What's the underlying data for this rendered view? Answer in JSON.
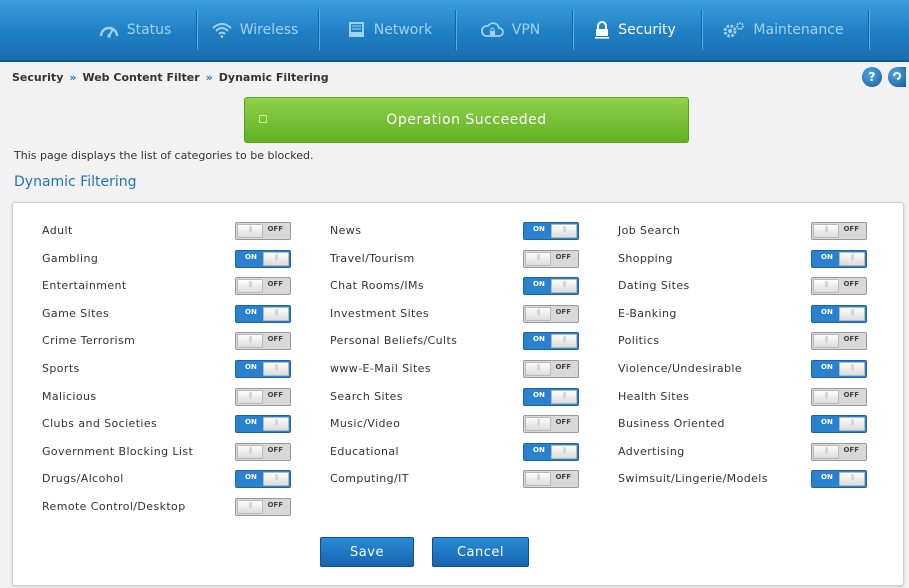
{
  "nav": {
    "tabs": [
      {
        "label": "Status",
        "icon": "gauge-icon",
        "active": false
      },
      {
        "label": "Wireless",
        "icon": "wifi-icon",
        "active": false
      },
      {
        "label": "Network",
        "icon": "monitor-icon",
        "active": false
      },
      {
        "label": "VPN",
        "icon": "cloud-lock-icon",
        "active": false
      },
      {
        "label": "Security",
        "icon": "lock-icon",
        "active": true
      },
      {
        "label": "Maintenance",
        "icon": "gears-icon",
        "active": false
      }
    ]
  },
  "breadcrumb": {
    "items": [
      "Security",
      "Web Content Filter",
      "Dynamic Filtering"
    ],
    "separator": "»"
  },
  "help": {
    "label": "?"
  },
  "banner": {
    "message": "Operation Succeeded"
  },
  "description": "This page displays the list of categories to be blocked.",
  "section_title": "Dynamic Filtering",
  "toggle_labels": {
    "on": "ON",
    "off": "OFF"
  },
  "categories": {
    "col1": [
      {
        "label": "Adult",
        "state": "OFF"
      },
      {
        "label": "Gambling",
        "state": "ON"
      },
      {
        "label": "Entertainment",
        "state": "OFF"
      },
      {
        "label": "Game Sites",
        "state": "ON"
      },
      {
        "label": "Crime Terrorism",
        "state": "OFF"
      },
      {
        "label": "Sports",
        "state": "ON"
      },
      {
        "label": "Malicious",
        "state": "OFF"
      },
      {
        "label": "Clubs and Societies",
        "state": "ON"
      },
      {
        "label": "Government Blocking List",
        "state": "OFF"
      },
      {
        "label": "Drugs/Alcohol",
        "state": "ON"
      },
      {
        "label": "Remote Control/Desktop",
        "state": "OFF"
      }
    ],
    "col2": [
      {
        "label": "News",
        "state": "ON"
      },
      {
        "label": "Travel/Tourism",
        "state": "OFF"
      },
      {
        "label": "Chat Rooms/IMs",
        "state": "ON"
      },
      {
        "label": "Investment Sites",
        "state": "OFF"
      },
      {
        "label": "Personal Beliefs/Cults",
        "state": "ON"
      },
      {
        "label": "www-E-Mail Sites",
        "state": "OFF"
      },
      {
        "label": "Search Sites",
        "state": "ON"
      },
      {
        "label": "Music/Video",
        "state": "OFF"
      },
      {
        "label": "Educational",
        "state": "ON"
      },
      {
        "label": "Computing/IT",
        "state": "OFF"
      }
    ],
    "col3": [
      {
        "label": "Job Search",
        "state": "OFF"
      },
      {
        "label": "Shopping",
        "state": "ON"
      },
      {
        "label": "Dating Sites",
        "state": "OFF"
      },
      {
        "label": "E-Banking",
        "state": "ON"
      },
      {
        "label": "Politics",
        "state": "OFF"
      },
      {
        "label": "Violence/Undesirable",
        "state": "ON"
      },
      {
        "label": "Health Sites",
        "state": "OFF"
      },
      {
        "label": "Business Oriented",
        "state": "ON"
      },
      {
        "label": "Advertising",
        "state": "OFF"
      },
      {
        "label": "Swimsuit/Lingerie/Models",
        "state": "ON"
      }
    ]
  },
  "actions": {
    "save": "Save",
    "cancel": "Cancel"
  },
  "colors": {
    "nav_blue": "#1f7fc4",
    "toggle_on": "#2a82cf",
    "success_green": "#63b122",
    "title_blue": "#2273b5"
  }
}
